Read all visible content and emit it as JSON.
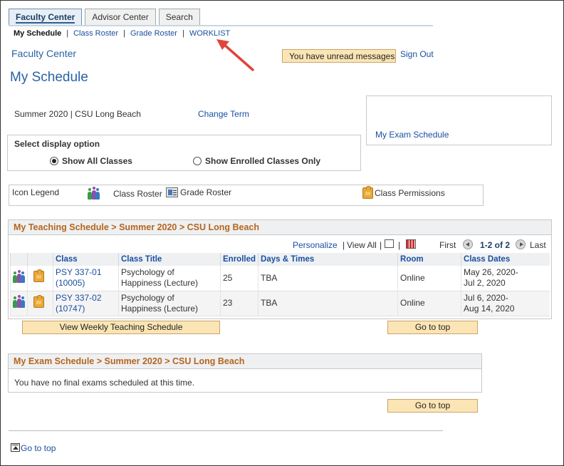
{
  "tabs": [
    {
      "label": "Faculty Center",
      "active": true
    },
    {
      "label": "Advisor Center",
      "active": false
    },
    {
      "label": "Search",
      "active": false
    }
  ],
  "subnav": {
    "current": "My Schedule",
    "links": [
      "Class Roster",
      "Grade Roster",
      "WORKLIST"
    ]
  },
  "header": {
    "section": "Faculty Center",
    "messages_button": "You have unread messages",
    "sign_out": "Sign Out",
    "page_title": "My Schedule"
  },
  "term": {
    "label": "Summer 2020 | CSU Long Beach",
    "change_term": "Change Term"
  },
  "exam_link": "My Exam Schedule",
  "display_option": {
    "heading": "Select display option",
    "options": [
      {
        "label": "Show All Classes",
        "selected": true
      },
      {
        "label": "Show Enrolled Classes Only",
        "selected": false
      }
    ]
  },
  "legend": {
    "title": "Icon Legend",
    "items": [
      "Class Roster",
      "Grade Roster",
      "Class Permissions"
    ]
  },
  "teaching": {
    "title": "My Teaching Schedule > Summer 2020 > CSU Long Beach",
    "personalize": "Personalize",
    "view_all": "View All",
    "first": "First",
    "range": "1-2 of 2",
    "last": "Last",
    "columns": [
      "Class",
      "Class Title",
      "Enrolled",
      "Days & Times",
      "Room",
      "Class Dates"
    ],
    "rows": [
      {
        "class_line1": "PSY 337-01",
        "class_line2": "(10005)",
        "title_line1": "Psychology of",
        "title_line2": "Happiness (Lecture)",
        "enrolled": "25",
        "days": "TBA",
        "room": "Online",
        "dates_line1": "May 26, 2020-",
        "dates_line2": "Jul 2, 2020"
      },
      {
        "class_line1": "PSY 337-02",
        "class_line2": "(10747)",
        "title_line1": "Psychology of",
        "title_line2": "Happiness (Lecture)",
        "enrolled": "23",
        "days": "TBA",
        "room": "Online",
        "dates_line1": "Jul 6, 2020-",
        "dates_line2": "Aug 14, 2020"
      }
    ],
    "weekly_button": "View Weekly Teaching Schedule",
    "go_to_top": "Go to top"
  },
  "exams": {
    "title": "My Exam Schedule > Summer 2020 > CSU Long Beach",
    "message": "You have no final exams scheduled at this time.",
    "go_to_top": "Go to top"
  },
  "footer": {
    "go_to_top": "Go to top"
  },
  "colors": {
    "link": "#1a4fa0",
    "panel_header_text": "#b5651d",
    "button_bg": "#fbe5b5",
    "annotation_arrow": "#e0453a"
  }
}
